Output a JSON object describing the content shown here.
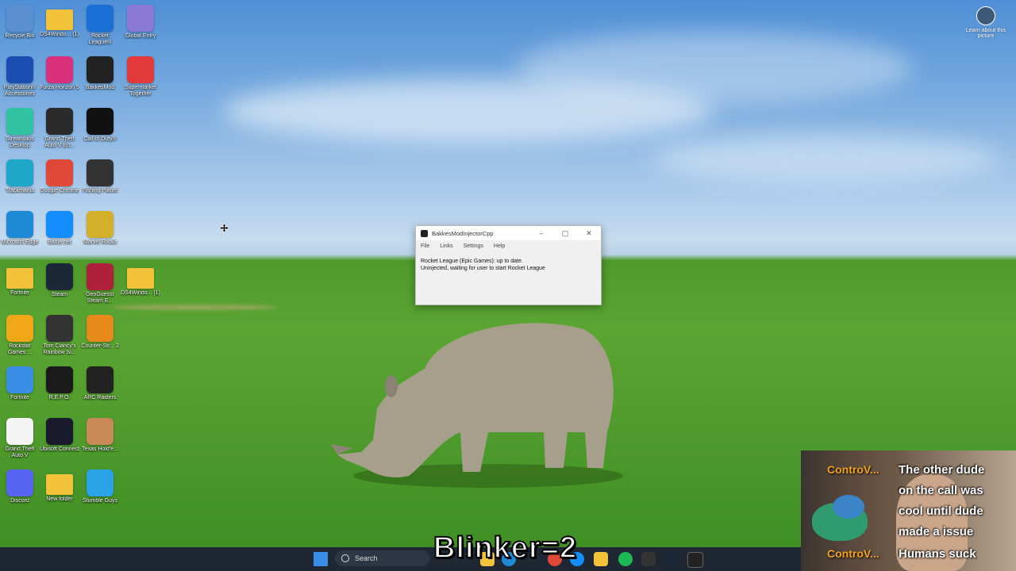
{
  "desktop": {
    "icons": [
      {
        "label": "Recycle Bin",
        "icon": "recycle-bin-icon",
        "color": "#5a8fd0"
      },
      {
        "label": "DS4Windo... (1)",
        "icon": "folder-icon",
        "color": "#f2c23a"
      },
      {
        "label": "Rocket League®",
        "icon": "rocket-league-icon",
        "color": "#1b6fd6"
      },
      {
        "label": "Global Entry",
        "icon": "global-city-icon",
        "color": "#8a7ad6"
      },
      {
        "label": "PlayStation® Accessories",
        "icon": "playstation-icon",
        "color": "#1c4db3"
      },
      {
        "label": "Forza Horizon 5",
        "icon": "forza-icon",
        "color": "#d8307a"
      },
      {
        "label": "BakkesMod",
        "icon": "bakkesmod-icon",
        "color": "#222222"
      },
      {
        "label": "Supermarket Together",
        "icon": "supermarket-icon",
        "color": "#e23a3a"
      },
      {
        "label": "Streamlabs Desktop",
        "icon": "streamlabs-icon",
        "color": "#31c3a2"
      },
      {
        "label": "Grand Theft Auto V En...",
        "icon": "gta-icon",
        "color": "#2b2b2b"
      },
      {
        "label": "Call of Duty®",
        "icon": "call-of-duty-icon",
        "color": "#111111"
      },
      {
        "label": "Trackmania",
        "icon": "trackmania-icon",
        "color": "#1ea7c9"
      },
      {
        "label": "Google Chrome",
        "icon": "chrome-icon",
        "color": "#e0483a"
      },
      {
        "label": "Fishing Planet",
        "icon": "fishing-planet-icon",
        "color": "#333333"
      },
      {
        "label": "Microsoft Edge",
        "icon": "edge-icon",
        "color": "#1e8ad6"
      },
      {
        "label": "Battle.net",
        "icon": "battlenet-icon",
        "color": "#148eff"
      },
      {
        "label": "Marvel Rivals",
        "icon": "marvel-rivals-icon",
        "color": "#d4b02a"
      },
      {
        "label": "Fortnite",
        "icon": "folder-icon",
        "color": "#f2c23a"
      },
      {
        "label": "Steam",
        "icon": "steam-icon",
        "color": "#1b2838"
      },
      {
        "label": "GeoGuessr Steam E...",
        "icon": "geoguessr-icon",
        "color": "#b0203a"
      },
      {
        "label": "DS4Windo... (1)",
        "icon": "folder-icon",
        "color": "#f2c23a"
      },
      {
        "label": "Rockstar Games ...",
        "icon": "rockstar-icon",
        "color": "#f0a818"
      },
      {
        "label": "Tom Clancy's Rainbow Si...",
        "icon": "rainbow-six-icon",
        "color": "#333333"
      },
      {
        "label": "Counter-Str... 2",
        "icon": "counter-strike-icon",
        "color": "#e88a1a"
      },
      {
        "label": "Fortnite",
        "icon": "fortnite-icon",
        "color": "#3a8ee6"
      },
      {
        "label": "R.E.P.O.",
        "icon": "repo-icon",
        "color": "#1a1a1a"
      },
      {
        "label": "ARC Raiders",
        "icon": "arc-raiders-icon",
        "color": "#222222"
      },
      {
        "label": "Grand Theft Auto V",
        "icon": "file-icon",
        "color": "#f4f4f4"
      },
      {
        "label": "Ubisoft Connect",
        "icon": "ubisoft-icon",
        "color": "#1a1a2e"
      },
      {
        "label": "Texas Hold'e...",
        "icon": "texas-holdem-icon",
        "color": "#c98a5a"
      },
      {
        "label": "Discord",
        "icon": "discord-icon",
        "color": "#5865f2"
      },
      {
        "label": "New folder",
        "icon": "folder-icon",
        "color": "#f2c23a"
      },
      {
        "label": "Stumble Guys",
        "icon": "stumble-guys-icon",
        "color": "#2aa3e8"
      }
    ],
    "learn_label": "Learn about this picture"
  },
  "window": {
    "title": "BakkesModInjectorCpp",
    "menu": [
      "File",
      "Links",
      "Settings",
      "Help"
    ],
    "status1": "Rocket League (Epic Games): up to date.",
    "status2": "Uninjected, waiting for user to start Rocket League"
  },
  "taskbar": {
    "search_label": "Search"
  },
  "stream": {
    "overlay_text": "Blinker=2",
    "chat_name1": "ControV...",
    "chat_msg1_lines": [
      "The other dude",
      "on the call was",
      "cool until dude",
      "made a issue"
    ],
    "chat_name2": "ControV...",
    "chat_msg2": "Humans suck"
  }
}
